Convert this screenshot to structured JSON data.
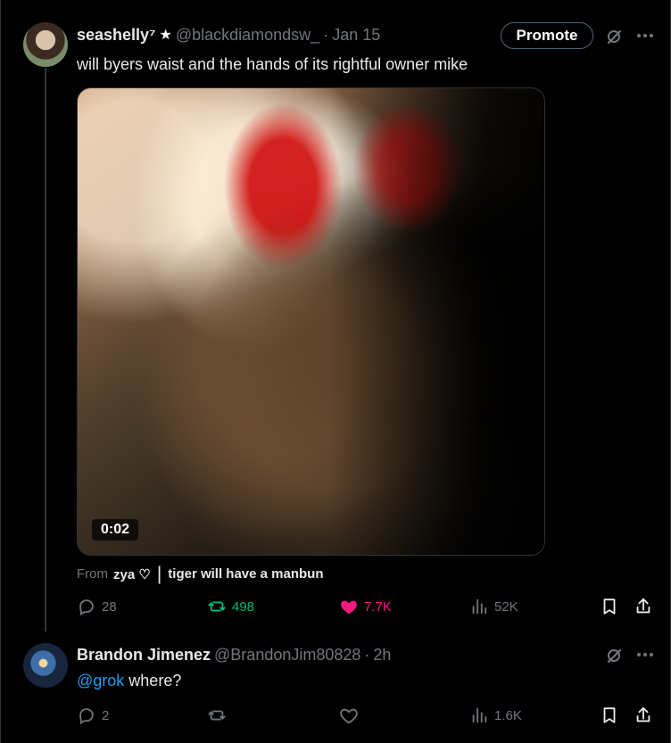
{
  "tweet": {
    "author_name": "seashelly⁷",
    "author_badge": "★",
    "author_handle": "@blackdiamondsw_",
    "separator": "·",
    "date": "Jan 15",
    "text": "will byers waist and the hands of its rightful owner mike",
    "promote_label": "Promote",
    "media": {
      "duration": "0:02"
    },
    "source": {
      "from_label": "From",
      "name": "zya ♡",
      "divider": "|",
      "title": "tiger will have a manbun"
    },
    "actions": {
      "replies": "28",
      "reposts": "498",
      "likes": "7.7K",
      "views": "52K"
    }
  },
  "reply": {
    "author_name": "Brandon Jimenez",
    "author_handle": "@BrandonJim80828",
    "separator": "·",
    "time": "2h",
    "mention": "@grok",
    "text": " where?",
    "actions": {
      "replies": "2",
      "reposts": "",
      "likes": "",
      "views": "1.6K"
    }
  },
  "colors": {
    "background": "#000000",
    "muted": "#71767b",
    "accent_blue": "#1d9bf0",
    "repost_green": "#00ba7c",
    "like_pink": "#f91880"
  },
  "icons": [
    "grok-icon",
    "more-icon",
    "reply-icon",
    "repost-icon",
    "like-icon",
    "views-icon",
    "bookmark-icon",
    "share-icon"
  ]
}
